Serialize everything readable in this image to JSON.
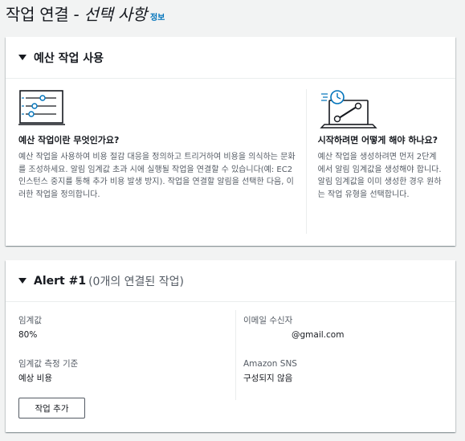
{
  "header": {
    "title_plain": "작업 연결 - ",
    "title_italic": "선택 사항",
    "info_link": "정보"
  },
  "howto_panel": {
    "title": "예산 작업 사용",
    "left": {
      "heading": "예산 작업이란 무엇인가요?",
      "body": "예산 작업을 사용하여 비용 절감 대응을 정의하고 트리거하여 비용을 의식하는 문화를 조성하세요. 알림 임계값 초과 시에 실행될 작업을 연결할 수 있습니다(예: EC2 인스턴스 중지를 통해 추가 비용 발생 방지). 작업을 연결할 알림을 선택한 다음, 이러한 작업을 정의합니다.",
      "icon": "sliders-icon"
    },
    "right": {
      "heading": "시작하려면 어떻게 해야 하나요?",
      "body": "예산 작업을 생성하려면 먼저 2단계에서 알림 임계값을 생성해야 합니다. 알림 임계값을 이미 생성한 경우 원하는 작업 유형을 선택합니다.",
      "icon": "laptop-wrench-icon"
    }
  },
  "alert_panel": {
    "title": "Alert #1",
    "subtitle": "(0개의 연결된 작업)",
    "threshold_label": "임계값",
    "threshold_value": "80%",
    "threshold_type_label": "임계값 측정 기준",
    "threshold_type_value": "예상 비용",
    "email_label": "이메일 수신자",
    "email_value": "@gmail.com",
    "sns_label": "Amazon SNS",
    "sns_value": "구성되지 않음",
    "add_action_label": "작업 추가"
  },
  "colors": {
    "link": "#0073bb",
    "page_bg": "#f2f3f3",
    "text": "#16191f",
    "secondary_text": "#545b64",
    "illustration_accent": "#0073bb"
  }
}
